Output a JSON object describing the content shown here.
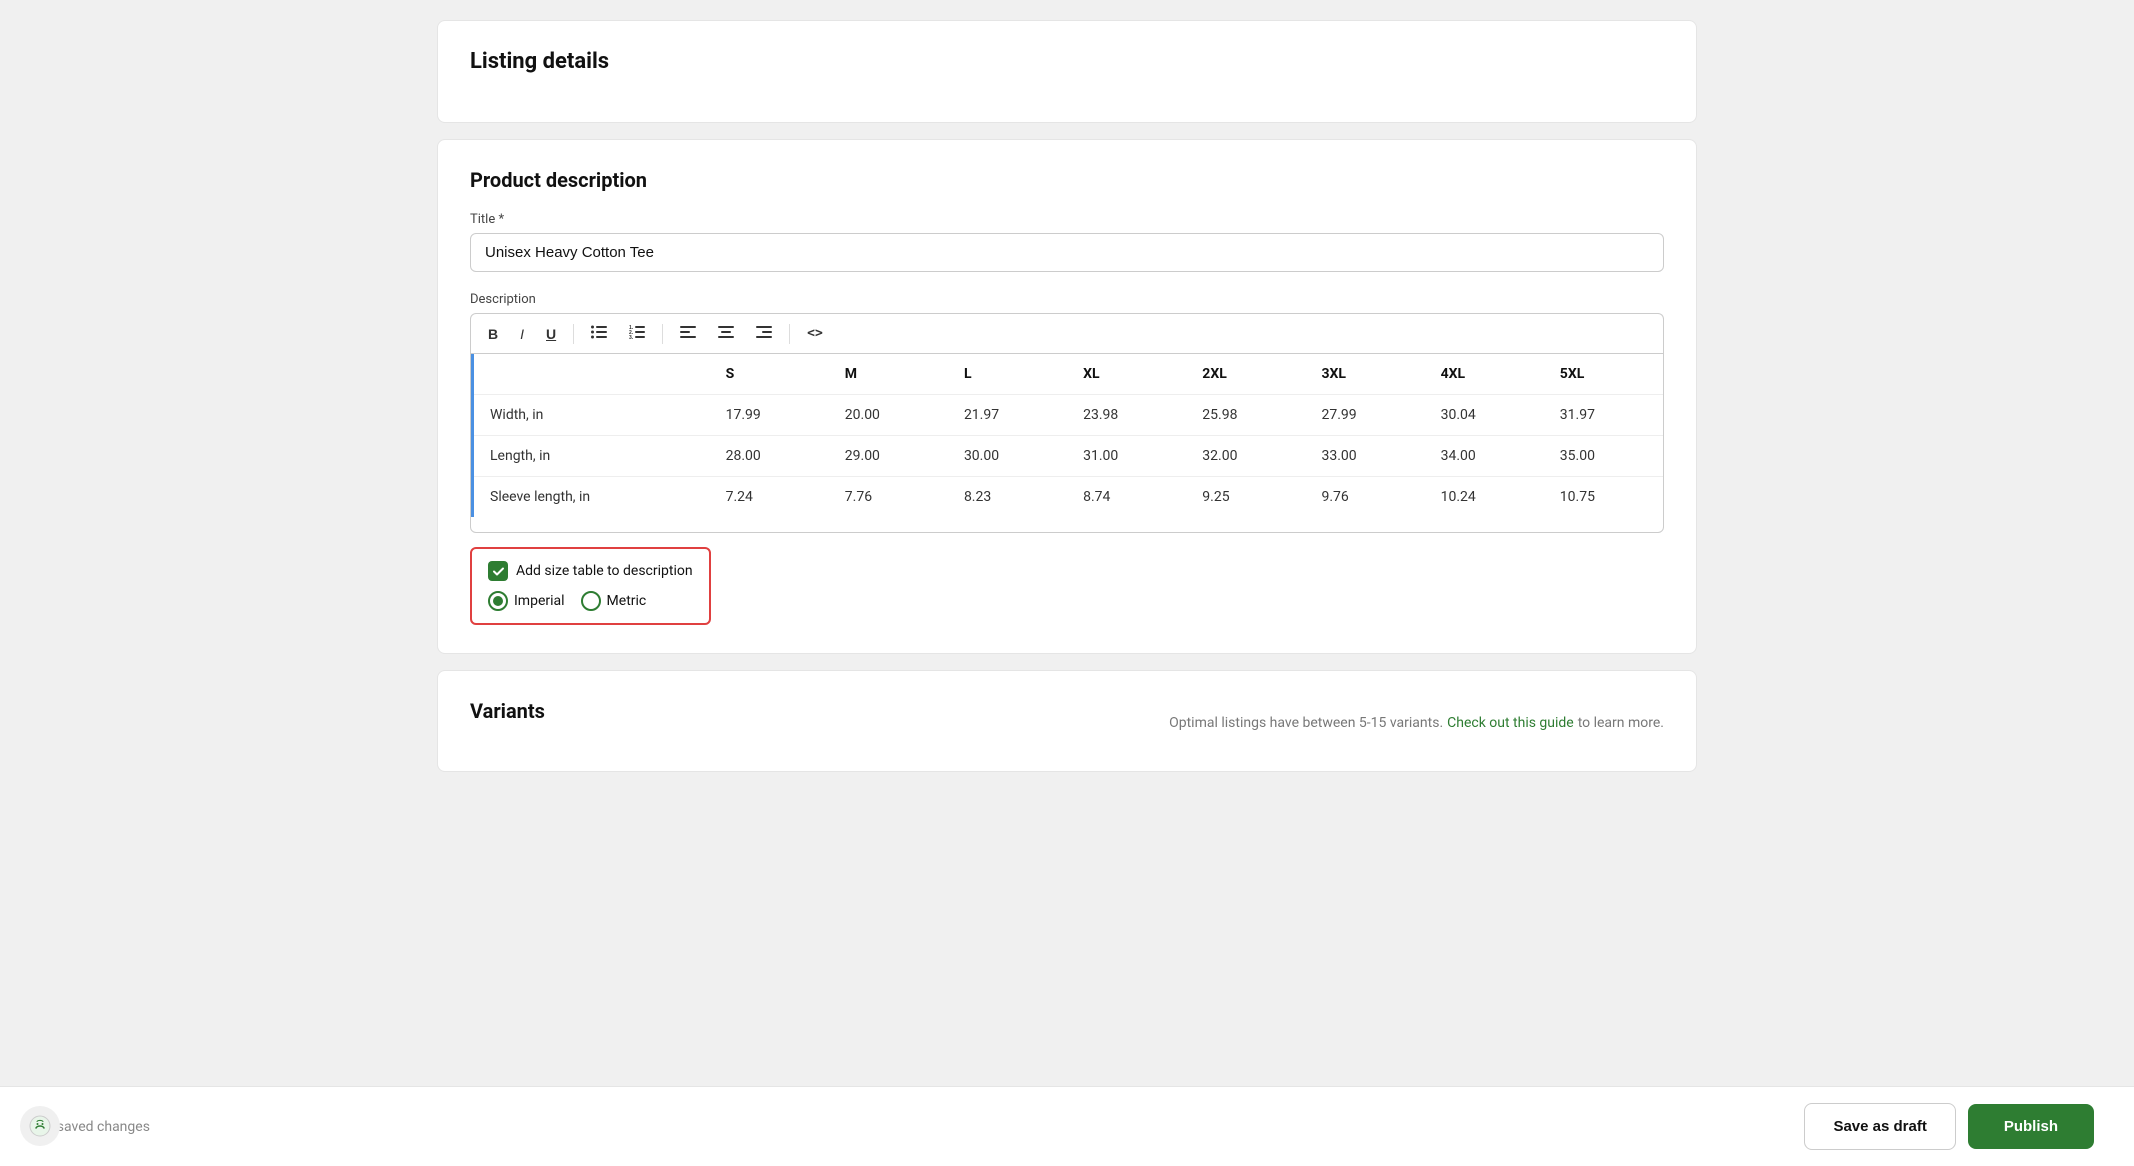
{
  "page": {
    "listing_details_title": "Listing details",
    "product_description_title": "Product description",
    "title_label": "Title *",
    "title_value": "Unisex Heavy Cotton Tee",
    "description_label": "Description",
    "toolbar": {
      "bold": "B",
      "italic": "I",
      "underline": "U",
      "bullet_list": "≡",
      "ordered_list": "≡",
      "align_left": "≡",
      "align_center": "≡",
      "align_right": "≡",
      "code": "<>"
    },
    "size_table": {
      "headers": [
        "",
        "S",
        "M",
        "L",
        "XL",
        "2XL",
        "3XL",
        "4XL",
        "5XL"
      ],
      "rows": [
        {
          "label": "Width, in",
          "values": [
            "17.99",
            "20.00",
            "21.97",
            "23.98",
            "25.98",
            "27.99",
            "30.04",
            "31.97"
          ]
        },
        {
          "label": "Length, in",
          "values": [
            "28.00",
            "29.00",
            "30.00",
            "31.00",
            "32.00",
            "33.00",
            "34.00",
            "35.00"
          ]
        },
        {
          "label": "Sleeve length, in",
          "values": [
            "7.24",
            "7.76",
            "8.23",
            "8.74",
            "9.25",
            "9.76",
            "10.24",
            "10.75"
          ]
        }
      ]
    },
    "add_size_table_label": "Add size table to description",
    "imperial_label": "Imperial",
    "metric_label": "Metric",
    "imperial_selected": true,
    "metric_selected": false,
    "variants_title": "Variants",
    "variants_hint": "Optimal listings have between 5-15 variants.",
    "variants_link_text": "Check out this guide",
    "variants_hint_suffix": "to learn more.",
    "footer_status": "Unsaved changes",
    "save_draft_label": "Save as draft",
    "publish_label": "Publish"
  }
}
